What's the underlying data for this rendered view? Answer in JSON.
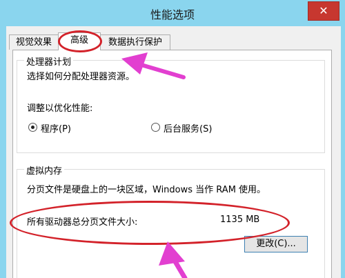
{
  "window": {
    "title": "性能选项",
    "close_glyph": "✕"
  },
  "tabs": [
    {
      "label": "视觉效果",
      "active": false
    },
    {
      "label": "高级",
      "active": true
    },
    {
      "label": "数据执行保护",
      "active": false
    }
  ],
  "processor_scheduling": {
    "legend": "处理器计划",
    "description": "选择如何分配处理器资源。",
    "adjust_label": "调整以优化性能:",
    "options": [
      {
        "label": "程序(P)",
        "selected": true
      },
      {
        "label": "后台服务(S)",
        "selected": false
      }
    ]
  },
  "virtual_memory": {
    "legend": "虚拟内存",
    "description": "分页文件是硬盘上的一块区域，Windows 当作 RAM 使用。",
    "total_label": "所有驱动器总分页文件大小:",
    "total_value": "1135 MB",
    "change_button": "更改(C)..."
  },
  "annotations": {
    "highlight_color": "#d3222a",
    "arrow_color": "#e23fd0"
  }
}
